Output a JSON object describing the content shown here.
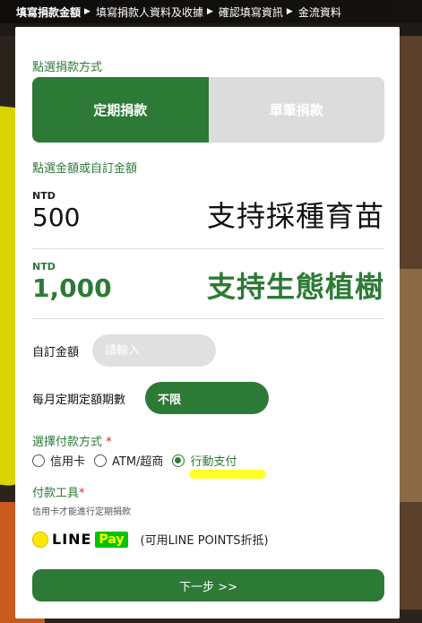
{
  "steps": {
    "items": [
      "填寫捐款金額",
      "填寫捐款人資料及收據",
      "確認填寫資訊",
      "金流資料"
    ],
    "arrow": "▶"
  },
  "donation": {
    "method_label": "點選捐款方式",
    "freq_options": [
      "定期捐款",
      "單筆捐款"
    ],
    "amount_label": "點選金額或自訂金額",
    "amounts": [
      {
        "currency": "NTD",
        "value": "500",
        "desc": "支持採種育苗"
      },
      {
        "currency": "NTD",
        "value": "1,000",
        "desc": "支持生態植樹"
      }
    ],
    "custom_label": "自訂金額",
    "custom_placeholder": "請輸入",
    "period_label": "每月定期定額期數",
    "period_value": "不限"
  },
  "payment": {
    "method_label": "選擇付款方式",
    "required_mark": "*",
    "options": [
      "信用卡",
      "ATM/超商",
      "行動支付"
    ],
    "selected": "行動支付",
    "tool_label": "付款工具",
    "tool_hint": "信用卡才能進行定期捐款",
    "linepay_line": "LINE",
    "linepay_pay": "Pay",
    "linepay_note": "(可用LINE POINTS折抵)"
  },
  "next_button": "下一步 >>",
  "colors": {
    "primary": "#2d7a36",
    "required": "#d12b2b",
    "highlight": "#ffff00"
  }
}
